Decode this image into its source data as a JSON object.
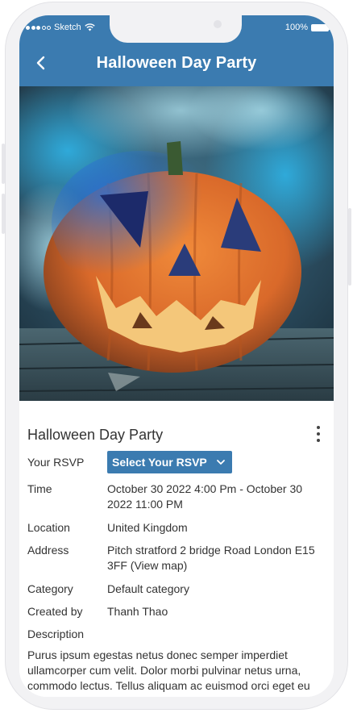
{
  "status_bar": {
    "carrier": "Sketch",
    "battery": "100%"
  },
  "header": {
    "title": "Halloween Day Party",
    "back_icon": "chevron-left-icon",
    "color": "#3b7bb0"
  },
  "hero_image": {
    "description_icon": "jack-o-lantern-photo"
  },
  "event": {
    "title": "Halloween Day Party",
    "more_icon": "vertical-dots-icon",
    "rsvp": {
      "label": "Your RSVP",
      "selected": "Select Your RSVP"
    },
    "time": {
      "label": "Time",
      "value": "October 30 2022 4:00 Pm - October 30 2022 11:00 PM"
    },
    "location": {
      "label": "Location",
      "value": "United Kingdom"
    },
    "address": {
      "label": "Address",
      "value": "Pitch stratford 2 bridge Road London E15 3FF (View map)"
    },
    "category": {
      "label": "Category",
      "value": "Default category"
    },
    "created_by": {
      "label": "Created by",
      "value": "Thanh Thao"
    },
    "description": {
      "label": "Description",
      "value": "Purus ipsum egestas netus donec semper imperdiet ullamcorper cum velit. Dolor morbi pulvinar netus urna, commodo lectus. Tellus aliquam ac euismod orci eget eu eget nec amet. Tristique quam praesent nam lectus"
    }
  }
}
